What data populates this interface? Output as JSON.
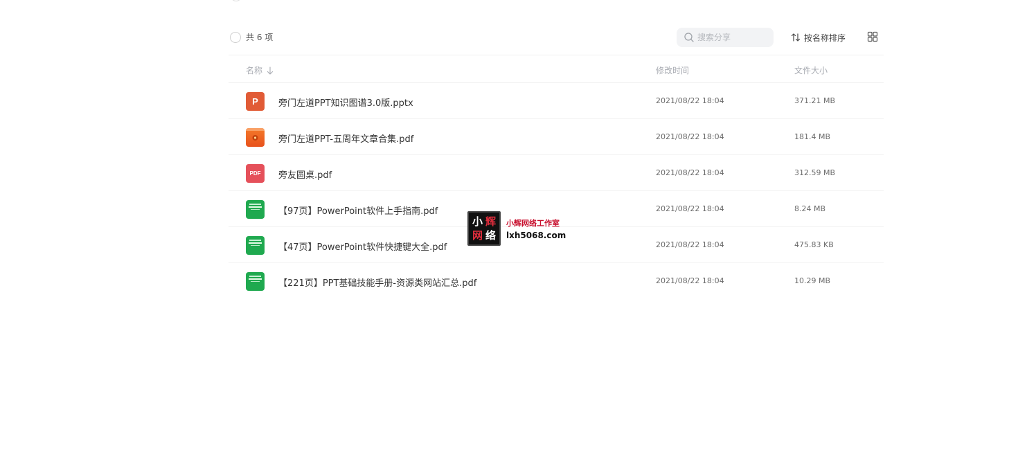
{
  "toolbar": {
    "count_label": "共 6 项",
    "search_placeholder": "搜索分享",
    "sort_label": "按名称排序"
  },
  "table": {
    "columns": {
      "name": "名称",
      "modified": "修改时间",
      "size": "文件大小"
    },
    "rows": [
      {
        "icon": "pptx-file-icon",
        "name": "旁门左道PPT知识图谱3.0版.pptx",
        "modified": "2021/08/22 18:04",
        "size": "371.21 MB"
      },
      {
        "icon": "book-cover-icon",
        "name": "旁门左道PPT-五周年文章合集.pdf",
        "modified": "2021/08/22 18:04",
        "size": "181.4 MB"
      },
      {
        "icon": "pdf-file-icon",
        "name": "旁友圆桌.pdf",
        "modified": "2021/08/22 18:04",
        "size": "312.59 MB"
      },
      {
        "icon": "book-cover-icon",
        "name": "【97页】PowerPoint软件上手指南.pdf",
        "modified": "2021/08/22 18:04",
        "size": "8.24 MB"
      },
      {
        "icon": "book-cover-icon",
        "name": "【47页】PowerPoint软件快捷键大全.pdf",
        "modified": "2021/08/22 18:04",
        "size": "475.83 KB"
      },
      {
        "icon": "book-cover-icon",
        "name": "【221页】PPT基础技能手册-资源类网站汇总.pdf",
        "modified": "2021/08/22 18:04",
        "size": "10.29 MB"
      }
    ],
    "pdf_badge": "PDF",
    "pptx_badge": "P"
  },
  "watermark": {
    "logo_chars": [
      "小",
      "辉",
      "网",
      "络"
    ],
    "title": "小辉网络工作室",
    "url": "lxh5068.com"
  },
  "colors": {
    "pptx": "#e15b36",
    "pdf": "#e5505a",
    "cover_green": "#1fa94f",
    "cover_orange": "#f47a2a"
  }
}
